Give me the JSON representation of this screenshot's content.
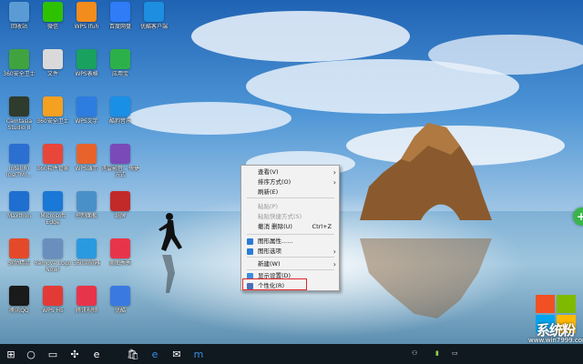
{
  "desktop": {
    "icons": [
      {
        "label": "回收站",
        "icon": "recycle-bin-icon",
        "color": "#5a9bd5"
      },
      {
        "label": "微信",
        "icon": "wechat-icon",
        "color": "#2dc100"
      },
      {
        "label": "WPS Ifuh",
        "icon": "wps-icon",
        "color": "#f28c1c"
      },
      {
        "label": "百度网盘",
        "icon": "baidu-netdisk-icon",
        "color": "#2f7cf6"
      },
      {
        "label": "优酷客户端",
        "icon": "youku-icon",
        "color": "#1d8ee0"
      },
      {
        "label": "360安全卫士",
        "icon": "shield-icon",
        "color": "#3fa33f"
      },
      {
        "label": "文件",
        "icon": "file-icon",
        "color": "#d9d9d9"
      },
      {
        "label": "WPS表格",
        "icon": "wps-spreadsheet-icon",
        "color": "#19a15f"
      },
      {
        "label": "应用宝",
        "icon": "app-store-icon",
        "color": "#2cb14a"
      },
      {
        "label": "Camtasia Studio 8",
        "icon": "camtasia-icon",
        "color": "#2f3b2c"
      },
      {
        "label": "360安全卫士",
        "icon": "security-guard-icon",
        "color": "#f4a020"
      },
      {
        "label": "WPS文字",
        "icon": "wps-writer-icon",
        "color": "#2d7de0"
      },
      {
        "label": "酷狗音乐",
        "icon": "kugou-icon",
        "color": "#1a8fe6"
      },
      {
        "label": "Intel(R) Iris(TM)...",
        "icon": "intel-graphics-icon",
        "color": "#2b6fd1"
      },
      {
        "label": "360软件管家",
        "icon": "software-manager-icon",
        "color": "#e8463a"
      },
      {
        "label": "WPS演示",
        "icon": "wps-presentation-icon",
        "color": "#e8632b"
      },
      {
        "label": "迅雷影音 - 快捷方式",
        "icon": "video-player-icon",
        "color": "#7a4bb8"
      },
      {
        "label": "Maxthon",
        "icon": "maxthon-icon",
        "color": "#1f6fd0"
      },
      {
        "label": "Microsoft Edge",
        "icon": "edge-icon",
        "color": "#1a78d6"
      },
      {
        "label": "控制面板",
        "icon": "control-panel-icon",
        "color": "#4a90c8"
      },
      {
        "label": "纸牌",
        "icon": "solitaire-icon",
        "color": "#c22a2a"
      },
      {
        "label": "驱动精灵",
        "icon": "driver-icon",
        "color": "#e44a2a"
      },
      {
        "label": "Remove Logo Now!",
        "icon": "remove-logo-icon",
        "color": "#6a8fbf"
      },
      {
        "label": "360浏览器",
        "icon": "browser-icon",
        "color": "#2a9ae0"
      },
      {
        "label": "美图秀秀",
        "icon": "meitu-icon",
        "color": "#e8344a"
      },
      {
        "label": "腾讯QQ",
        "icon": "qq-icon",
        "color": "#1a1a1a"
      },
      {
        "label": "WPS H5",
        "icon": "wps-h5-icon",
        "color": "#e33a36"
      },
      {
        "label": "腾讯视频",
        "icon": "tencent-video-icon",
        "color": "#e8344a"
      },
      {
        "label": "优酷",
        "icon": "youku-video-icon",
        "color": "#3a7ae0"
      }
    ]
  },
  "context_menu": {
    "items": [
      {
        "label": "查看(V)",
        "shortcut": "",
        "submenu": true,
        "disabled": false,
        "icon": ""
      },
      {
        "label": "排序方式(O)",
        "shortcut": "",
        "submenu": true,
        "disabled": false,
        "icon": ""
      },
      {
        "label": "刷新(E)",
        "shortcut": "",
        "submenu": false,
        "disabled": false,
        "icon": ""
      },
      {
        "label": "粘贴(P)",
        "shortcut": "",
        "submenu": false,
        "disabled": true,
        "icon": ""
      },
      {
        "label": "粘贴快捷方式(S)",
        "shortcut": "",
        "submenu": false,
        "disabled": true,
        "icon": ""
      },
      {
        "label": "撤消 删除(U)",
        "shortcut": "Ctrl+Z",
        "submenu": false,
        "disabled": false,
        "icon": ""
      },
      {
        "label": "图形属性......",
        "shortcut": "",
        "submenu": false,
        "disabled": false,
        "icon": "graphics-properties-icon"
      },
      {
        "label": "图形选项",
        "shortcut": "",
        "submenu": true,
        "disabled": false,
        "icon": "graphics-options-icon"
      },
      {
        "label": "新建(W)",
        "shortcut": "",
        "submenu": true,
        "disabled": false,
        "icon": ""
      },
      {
        "label": "显示设置(D)",
        "shortcut": "",
        "submenu": false,
        "disabled": false,
        "icon": "display-settings-icon"
      },
      {
        "label": "个性化(R)",
        "shortcut": "",
        "submenu": false,
        "disabled": false,
        "icon": "personalize-icon"
      }
    ],
    "highlight_color": "#e0242a"
  },
  "taskbar": {
    "buttons": [
      "start-icon",
      "search-icon",
      "task-view-icon",
      "pinwheel-app-icon",
      "ie-icon",
      "store-icon",
      "edge-icon",
      "mail-icon",
      "maxthon-icon"
    ],
    "tray": [
      "people-icon",
      "network-icon",
      "battery-icon"
    ]
  },
  "watermark": {
    "brand": "系统粉",
    "url": "www.win7999.com"
  }
}
